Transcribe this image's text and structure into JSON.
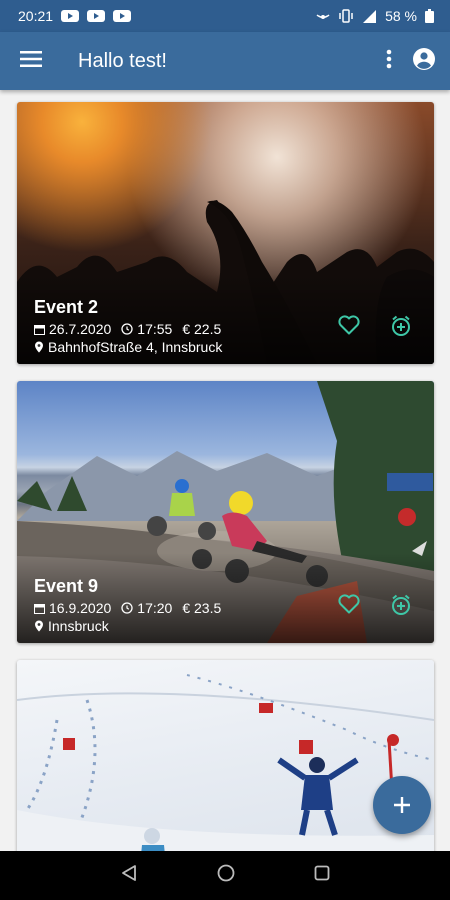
{
  "status_bar": {
    "time": "20:21",
    "battery": "58 %"
  },
  "app_bar": {
    "title": "Hallo test!"
  },
  "events": [
    {
      "title": "Event 2",
      "date": "26.7.2020",
      "time": "17:55",
      "price": "€ 22.5",
      "location": "BahnhofStraße 4, Innsbruck"
    },
    {
      "title": "Event 9",
      "date": "16.9.2020",
      "time": "17:20",
      "price": "€ 23.5",
      "location": "Innsbruck"
    }
  ],
  "colors": {
    "primary": "#3a6b9c",
    "status_bar": "#2f5d8f",
    "accent": "#3ec7a7"
  },
  "icons": [
    "menu-icon",
    "more-vert-icon",
    "account-circle-icon",
    "calendar-icon",
    "clock-icon",
    "location-pin-icon",
    "heart-outline-icon",
    "alarm-add-icon",
    "plus-icon",
    "back-icon",
    "home-icon",
    "recents-icon"
  ]
}
